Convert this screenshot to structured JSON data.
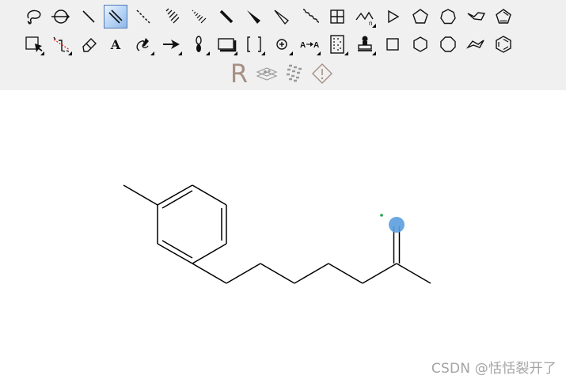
{
  "toolbar": {
    "rows": [
      {
        "tools": [
          {
            "icon": "lasso-select-icon",
            "type": "lasso"
          },
          {
            "icon": "rotate-icon",
            "type": "rotate"
          },
          {
            "icon": "single-bond-icon",
            "type": "single"
          },
          {
            "icon": "double-bond-icon",
            "type": "double",
            "selected": true
          },
          {
            "icon": "dashed-bond-icon",
            "type": "dashed"
          },
          {
            "icon": "hashed-bond-icon",
            "type": "hashed"
          },
          {
            "icon": "hashed-wedge-bond-icon",
            "type": "hashwedge"
          },
          {
            "icon": "bold-bond-icon",
            "type": "bold"
          },
          {
            "icon": "wedge-bond-icon",
            "type": "wedge"
          },
          {
            "icon": "hollow-wedge-bond-icon",
            "type": "hollowwedge"
          },
          {
            "icon": "wavy-bond-icon",
            "type": "wavy"
          },
          {
            "icon": "grid-table-icon",
            "type": "grid"
          },
          {
            "icon": "chain-icon",
            "type": "chain",
            "corner": true
          },
          {
            "icon": "cyclopropane-ring-icon",
            "type": "triangle"
          },
          {
            "icon": "cyclopentane-ring-icon",
            "type": "pentagon"
          },
          {
            "icon": "cycloheptane-ring-icon",
            "type": "heptagon"
          },
          {
            "icon": "cyclohexane-chair-icon",
            "type": "chair"
          },
          {
            "icon": "cyclopentadiene-ring-icon",
            "type": "cyclopentadiene"
          }
        ]
      },
      {
        "tools": [
          {
            "icon": "marquee-select-icon",
            "type": "marquee",
            "corner": true
          },
          {
            "icon": "structure-perspective-icon",
            "type": "perspective",
            "corner": true
          },
          {
            "icon": "eraser-icon",
            "type": "eraser"
          },
          {
            "icon": "text-tool-icon",
            "type": "text"
          },
          {
            "icon": "pen-tool-icon",
            "type": "pen",
            "corner": true
          },
          {
            "icon": "reaction-arrow-icon",
            "type": "arrow",
            "corner": true
          },
          {
            "icon": "orbital-icon",
            "type": "orbital",
            "corner": true
          },
          {
            "icon": "drawing-element-icon",
            "type": "box",
            "corner": true
          },
          {
            "icon": "brackets-icon",
            "type": "brackets",
            "corner": true
          },
          {
            "icon": "charge-icon",
            "type": "charge",
            "corner": true
          },
          {
            "icon": "mapping-tool-icon",
            "type": "mapping",
            "corner": true
          },
          {
            "icon": "query-tool-icon",
            "type": "query",
            "corner": true
          },
          {
            "icon": "template-stamp-icon",
            "type": "stamp",
            "corner": true
          },
          {
            "icon": "cyclobutane-ring-icon",
            "type": "square"
          },
          {
            "icon": "cyclohexane-ring-icon",
            "type": "hexagon"
          },
          {
            "icon": "cyclooctane-ring-icon",
            "type": "octagon"
          },
          {
            "icon": "cyclohexane-boat-icon",
            "type": "boat"
          },
          {
            "icon": "benzene-ring-icon",
            "type": "benzene"
          }
        ]
      },
      {
        "tools": [
          {
            "icon": "r-group-icon",
            "type": "rgroup",
            "label": "R"
          },
          {
            "icon": "tlc-plate-icon",
            "type": "tlc"
          },
          {
            "icon": "gel-electrophoresis-icon",
            "type": "gel"
          },
          {
            "icon": "warning-diamond-icon",
            "type": "warning"
          }
        ]
      }
    ]
  },
  "canvas": {
    "molecule": "methylphenyl alkyl chain with terminal alkene",
    "bond_color": "#000000",
    "highlight_color": "#5b9fde",
    "dot_color": "#1fa34a"
  },
  "watermark": "CSDN @恬恬裂开了"
}
